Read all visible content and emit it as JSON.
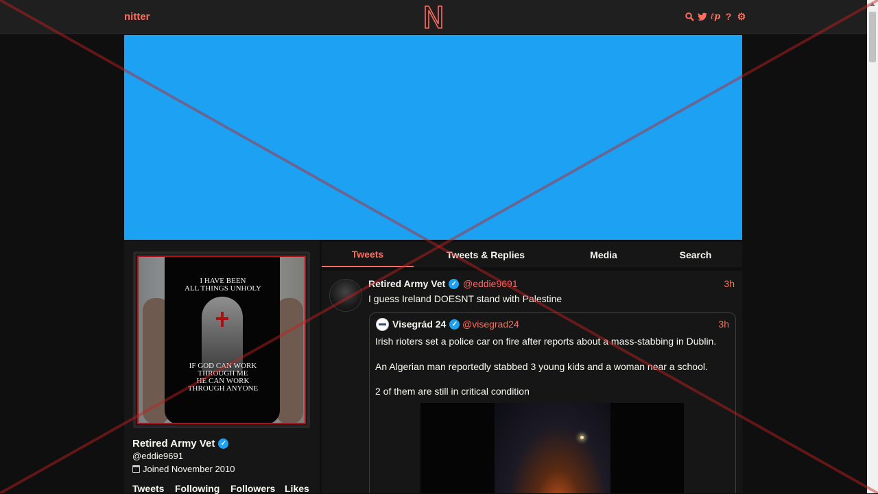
{
  "nav": {
    "brand": "nitter",
    "icons": [
      "search-icon",
      "twitter-bird-icon",
      "lp-icon",
      "help-icon",
      "settings-gear-icon"
    ],
    "accent_color": "#ff6c60"
  },
  "banner": {
    "color": "#1da1f2"
  },
  "profile": {
    "avatar_shirt_text_top": [
      "I HAVE BEEN",
      "ALL THINGS UNHOLY"
    ],
    "avatar_shirt_text_bottom": [
      "IF GOD CAN WORK",
      "THROUGH ME",
      "HE CAN WORK",
      "THROUGH ANYONE"
    ],
    "name": "Retired Army Vet",
    "handle": "@eddie9691",
    "joined": "Joined November 2010",
    "stats": [
      "Tweets",
      "Following",
      "Followers",
      "Likes"
    ]
  },
  "tabs": [
    {
      "label": "Tweets",
      "active": true
    },
    {
      "label": "Tweets & Replies",
      "active": false
    },
    {
      "label": "Media",
      "active": false
    },
    {
      "label": "Search",
      "active": false
    }
  ],
  "tweet": {
    "name": "Retired Army Vet",
    "handle": "@eddie9691",
    "time": "3h",
    "text": "I guess Ireland DOESNT stand with Palestine",
    "quote": {
      "name": "Visegrád 24",
      "handle": "@visegrad24",
      "time": "3h",
      "lines": [
        "Irish rioters set a police car on fire after reports about a mass-stabbing in Dublin.",
        "An Algerian man reportedly stabbed 3 young kids and a woman near a school.",
        "2 of them are still in critical condition"
      ]
    }
  }
}
